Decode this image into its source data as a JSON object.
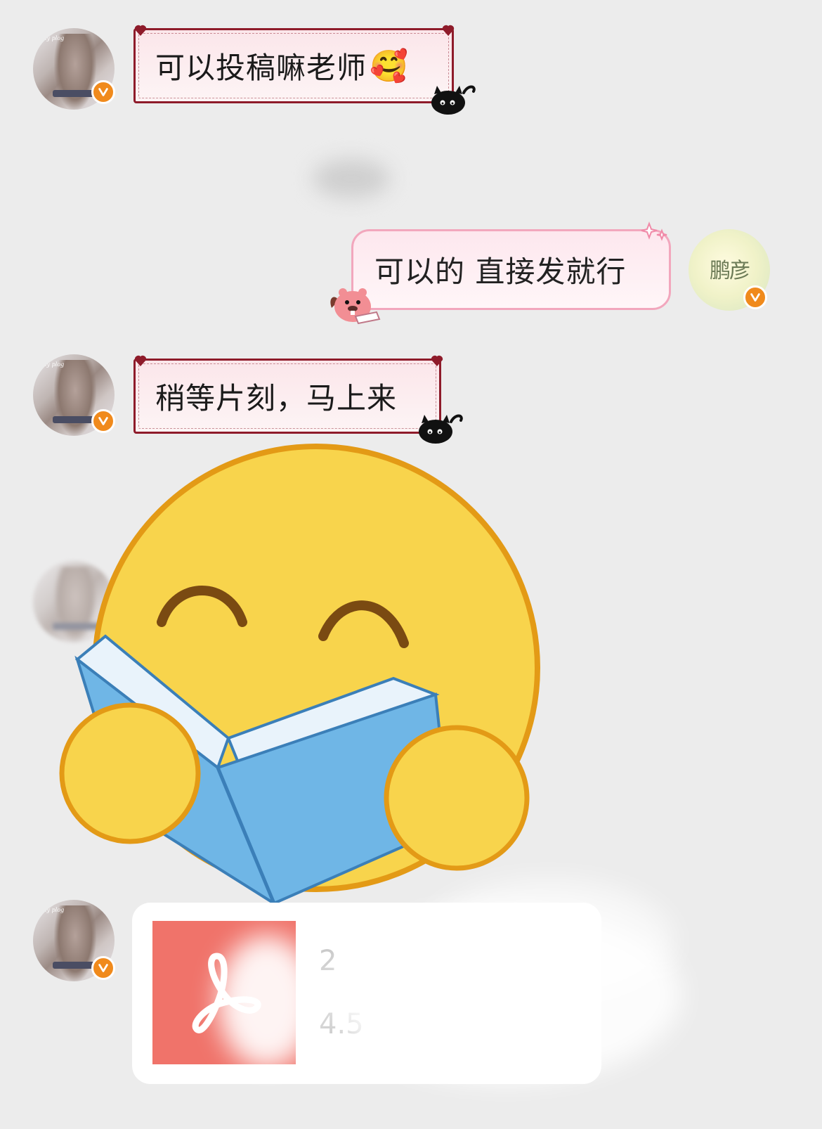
{
  "messages": [
    {
      "id": "m1",
      "side": "left",
      "text": "可以投稿嘛老师",
      "emoji": "🥰"
    },
    {
      "id": "m2",
      "side": "right",
      "text": "可以的 直接发就行"
    },
    {
      "id": "m3",
      "side": "left",
      "text": "稍等片刻，马上来"
    }
  ],
  "avatars": {
    "sender_caption": "my plog",
    "receiver_glyph": "鹏彦"
  },
  "file": {
    "meta_line1": "2",
    "meta_line2": "4.5"
  },
  "icons": {
    "verify_badge": "check-v-icon",
    "pdf": "acrobat-pdf-icon",
    "cat": "black-cat-icon",
    "beaver": "beaver-icon",
    "heart": "heart-icon",
    "sticker": "reading-emoji-icon"
  },
  "colors": {
    "background": "#ececec",
    "left_bubble_border": "#8e1b2a",
    "right_bubble_border": "#f2a7bd",
    "verify_badge": "#f08a1c",
    "pdf_tile": "#f0736a",
    "emoji_face": "#f8d44c",
    "book": "#6fb6e6"
  }
}
